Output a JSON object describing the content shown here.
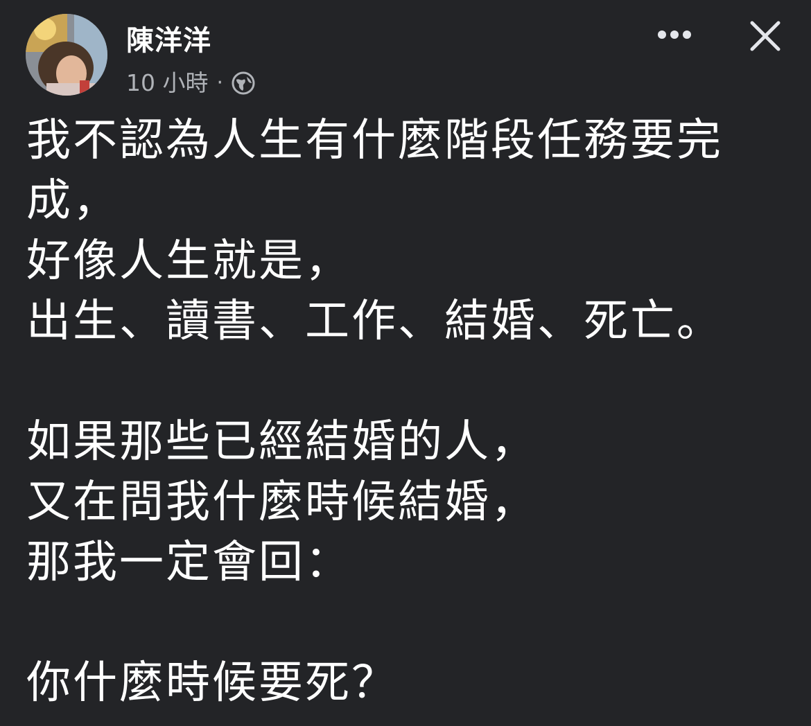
{
  "post": {
    "author_name": "陳洋洋",
    "timestamp": "10 小時",
    "separator": "·",
    "privacy_icon": "globe-icon",
    "lines": [
      "我不認為人生有什麼階段任務要完",
      "成，",
      "好像人生就是，",
      "出生、讀書、工作、結婚、死亡。",
      "",
      "如果那些已經結婚的人，",
      "又在問我什麼時候結婚，",
      "那我一定會回：",
      "",
      "你什麼時候要死？"
    ]
  },
  "header": {
    "more_icon": "more-horizontal-icon",
    "close_icon": "close-icon"
  },
  "colors": {
    "background": "#232427",
    "text": "#ffffff",
    "meta_text": "#b0b3b8",
    "icon": "#e4e6eb"
  }
}
